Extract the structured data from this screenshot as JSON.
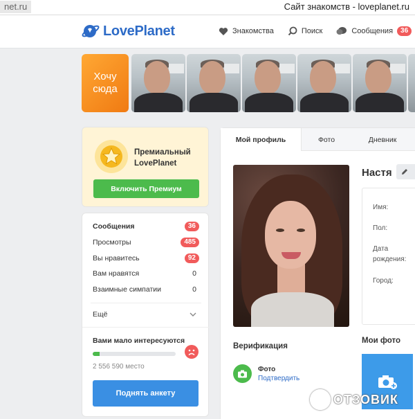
{
  "browser": {
    "url_fragment": "net.ru",
    "window_title": "Сайт знакомств - loveplanet.ru"
  },
  "header": {
    "logo_text": "LovePlanet",
    "nav": [
      {
        "label": "Знакомства",
        "icon": "heart-icon"
      },
      {
        "label": "Поиск",
        "icon": "search-icon"
      },
      {
        "label": "Сообщения",
        "icon": "chat-icon",
        "badge": "36"
      }
    ]
  },
  "strip": {
    "want_here": "Хочу сюда",
    "thumb_count_label": "6"
  },
  "premium": {
    "title": "Премиальный LovePlanet",
    "button": "Включить Премиум"
  },
  "stats": {
    "rows": [
      {
        "label": "Сообщения",
        "value": "36"
      },
      {
        "label": "Просмотры",
        "value": "485"
      },
      {
        "label": "Вы нравитесь",
        "value": "92"
      },
      {
        "label": "Вам нравятся",
        "value": "0"
      },
      {
        "label": "Взаимные симпатии",
        "value": "0"
      }
    ],
    "more_label": "Ещё",
    "low_interest": "Вами мало интересуются",
    "progress_fraction": 0.08,
    "place": "2 556 590 место",
    "raise_button": "Поднять анкету"
  },
  "profile": {
    "tabs": [
      "Мой профиль",
      "Фото",
      "Дневник"
    ],
    "name": "Настя",
    "fields": [
      "Имя:",
      "Пол:",
      "Дата рождения:",
      "Город:"
    ],
    "verification_title": "Верификация",
    "verification_item": "Фото",
    "verification_link": "Подтвердить",
    "my_photos_title": "Мои фото"
  },
  "watermark": {
    "text": "ОТЗОВИК"
  },
  "colors": {
    "brand_blue": "#2d6bc7",
    "accent_green": "#4cbb4c",
    "badge_red": "#f15b5b",
    "orange": "#f07a12"
  }
}
